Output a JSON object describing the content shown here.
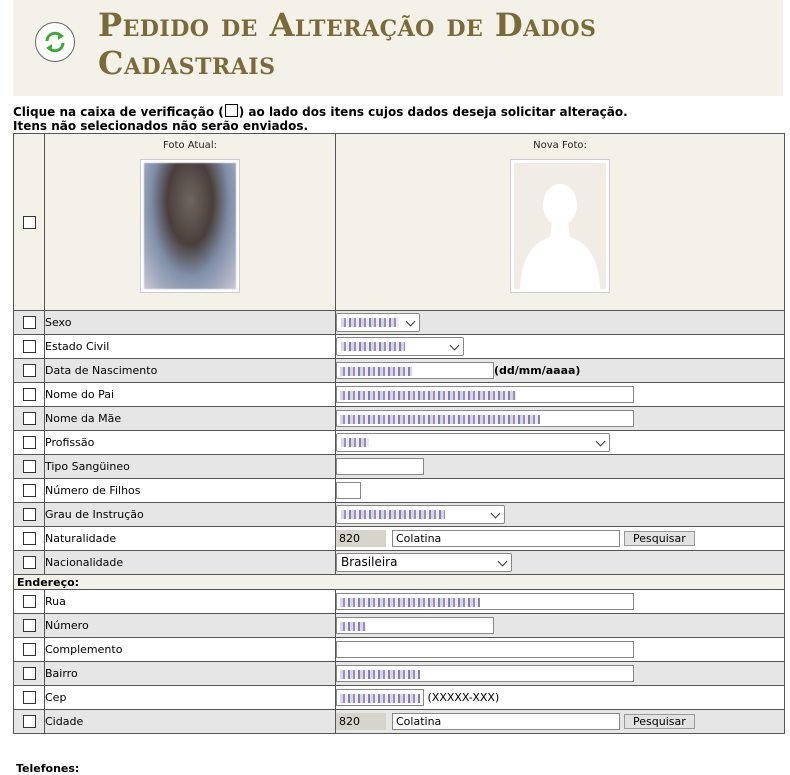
{
  "header": {
    "title": "Pedido de Alteração de Dados Cadastrais",
    "icon": "refresh-icon",
    "icon_color": "#3aaa35"
  },
  "instructions": {
    "line1_part1": "Clique na caixa de verificação (",
    "line1_part2": ") ao lado dos itens cujos dados deseja solicitar alteração.",
    "line2": "Itens não selecionados não serão enviados."
  },
  "photos": {
    "current_label": "Foto Atual:",
    "new_label": "Nova Foto:"
  },
  "fields": {
    "sexo": "Sexo",
    "estado_civil": "Estado Civil",
    "data_nascimento": "Data de Nascimento",
    "data_hint": "(dd/mm/aaaa)",
    "nome_pai": "Nome do Pai",
    "nome_mae": "Nome da Mãe",
    "profissao": "Profissão",
    "tipo_sanguineo": "Tipo Sangüineo",
    "numero_filhos": "Número de Filhos",
    "grau_instrucao": "Grau de Instrução",
    "naturalidade": "Naturalidade",
    "naturalidade_code": "820",
    "naturalidade_city": "Colatina",
    "nacionalidade": "Nacionalidade",
    "nacionalidade_value": "Brasileira"
  },
  "address": {
    "section_label": "Endereço:",
    "rua": "Rua",
    "numero": "Número",
    "complemento": "Complemento",
    "bairro": "Bairro",
    "cep": "Cep",
    "cep_hint": "(XXXXX-XXX)",
    "cidade": "Cidade",
    "cidade_code": "820",
    "cidade_city": "Colatina"
  },
  "buttons": {
    "pesquisar": "Pesquisar"
  },
  "phones": {
    "section_label": "Telefones:"
  },
  "colors": {
    "title": "#7a6a3a",
    "header_bg": "#f4f1e8",
    "row_gray": "#e6e6e6"
  }
}
